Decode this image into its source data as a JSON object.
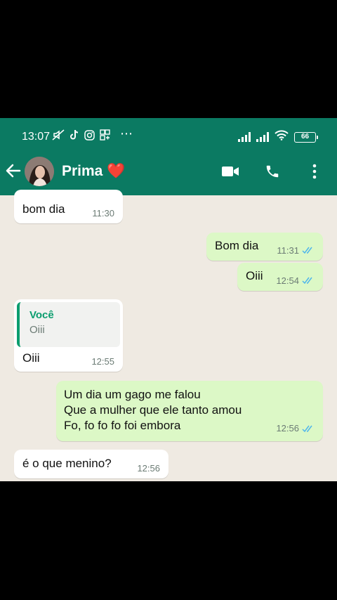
{
  "status_bar": {
    "time": "13:07",
    "battery": "66",
    "more": "⋯"
  },
  "header": {
    "contact_name": "Prima",
    "emoji": "❤️"
  },
  "messages": [
    {
      "direction": "in",
      "text": "bom dia",
      "time": "11:30"
    },
    {
      "direction": "out",
      "text": "Bom dia",
      "time": "11:31",
      "status": "read"
    },
    {
      "direction": "out",
      "text": "Oiii",
      "time": "12:54",
      "status": "read"
    },
    {
      "direction": "in",
      "quote_author": "Você",
      "quote_text": "Oiii",
      "text": "Oiii",
      "time": "12:55"
    },
    {
      "direction": "out",
      "lines": [
        "Um dia um gago me falou",
        "Que a mulher que ele tanto amou",
        "Fo, fo fo fo foi embora"
      ],
      "time": "12:56",
      "status": "read"
    },
    {
      "direction": "in",
      "text": "é o que menino?",
      "time": "12:56"
    }
  ],
  "colors": {
    "header": "#0b7a62",
    "chat_background": "#efeae2",
    "outgoing_bubble": "#dcf8c6",
    "incoming_bubble": "#ffffff",
    "read_ticks": "#4fb6ec"
  }
}
